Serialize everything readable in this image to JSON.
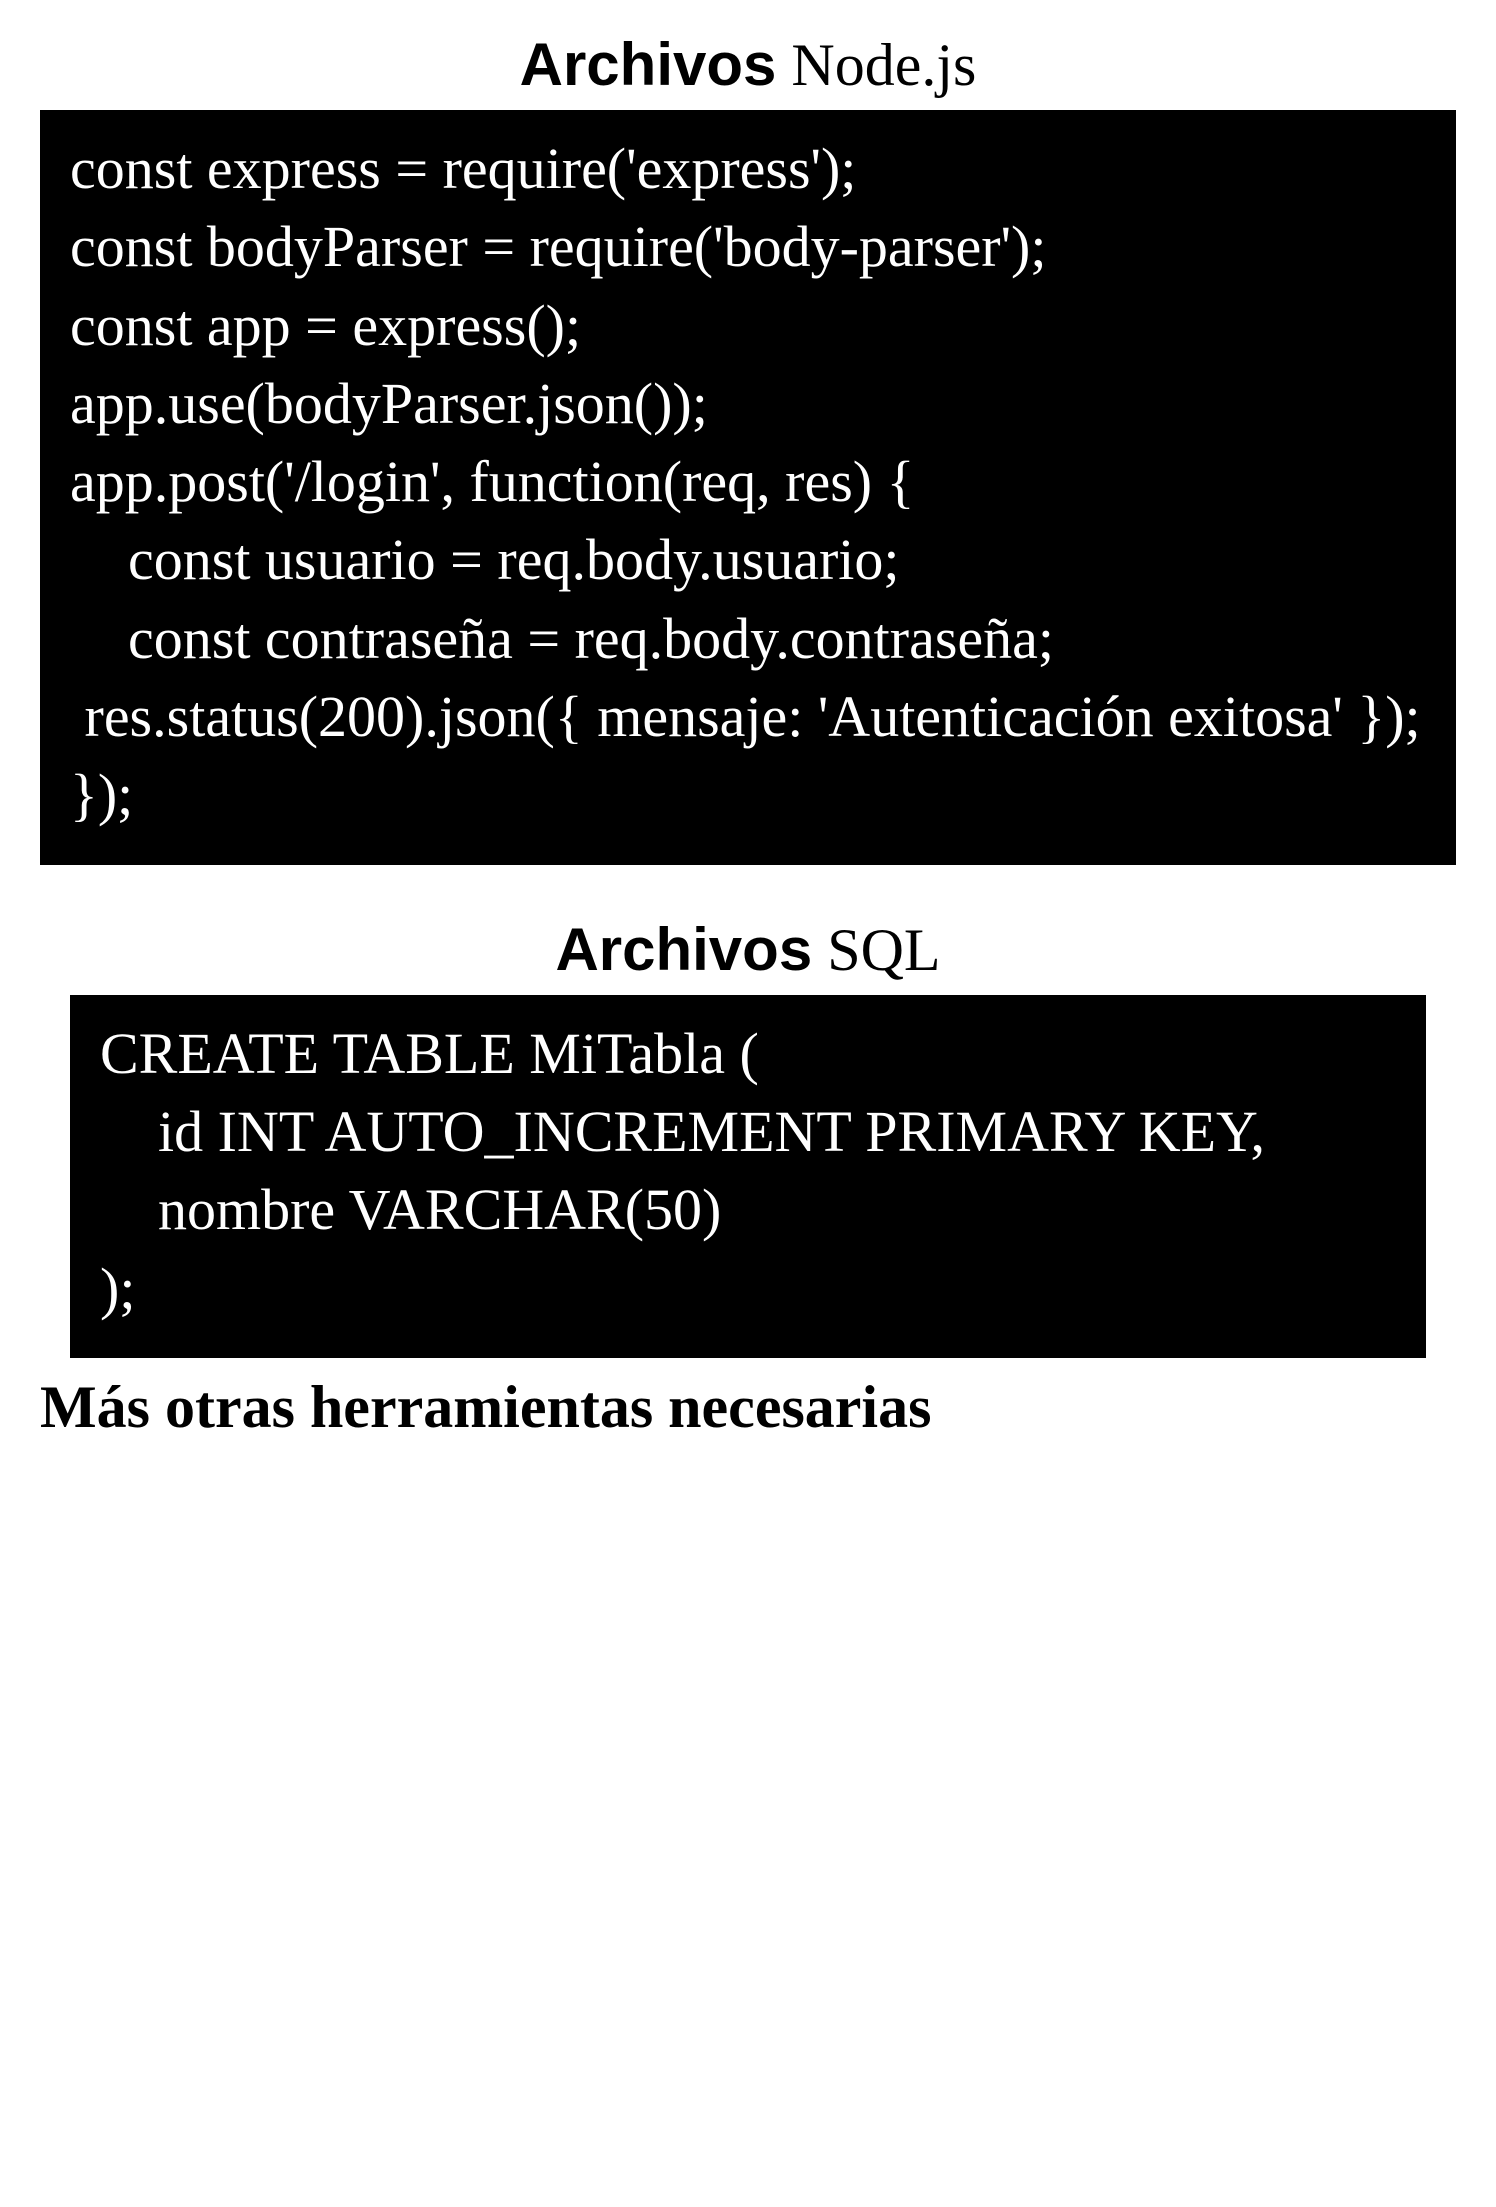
{
  "section1": {
    "heading_bold": "Archivos",
    "heading_normal": " Node.js",
    "code": "const express = require('express');\nconst bodyParser = require('body-parser');\nconst app = express();\napp.use(bodyParser.json());\napp.post('/login', function(req, res) {\n    const usuario = req.body.usuario;\n    const contraseña = req.body.contraseña;\n res.status(200).json({ mensaje: 'Autenticación exitosa' });\n});"
  },
  "section2": {
    "heading_bold": "Archivos",
    "heading_normal": " SQL",
    "code": "CREATE TABLE MiTabla (\n    id INT AUTO_INCREMENT PRIMARY KEY,\n    nombre VARCHAR(50)\n);"
  },
  "footer": "Más otras herramientas necesarias"
}
